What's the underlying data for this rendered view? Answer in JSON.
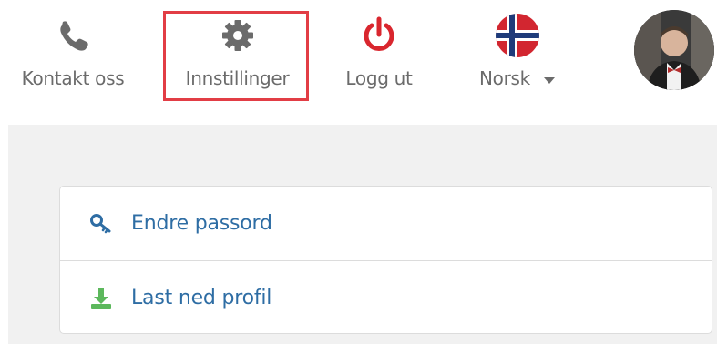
{
  "nav": {
    "contact_label": "Kontakt oss",
    "settings_label": "Innstillinger",
    "logout_label": "Logg ut",
    "language_label": "Norsk"
  },
  "settings_menu": {
    "items": [
      {
        "label": "Endre passord",
        "icon": "key-icon"
      },
      {
        "label": "Last ned profil",
        "icon": "download-icon"
      }
    ]
  },
  "colors": {
    "nav_text": "#6b6b6b",
    "logout_red": "#d9262e",
    "link_blue": "#2e6da4",
    "download_green": "#5cb85c",
    "highlight_red": "#e23d45",
    "content_bg": "#f1f1f1"
  }
}
